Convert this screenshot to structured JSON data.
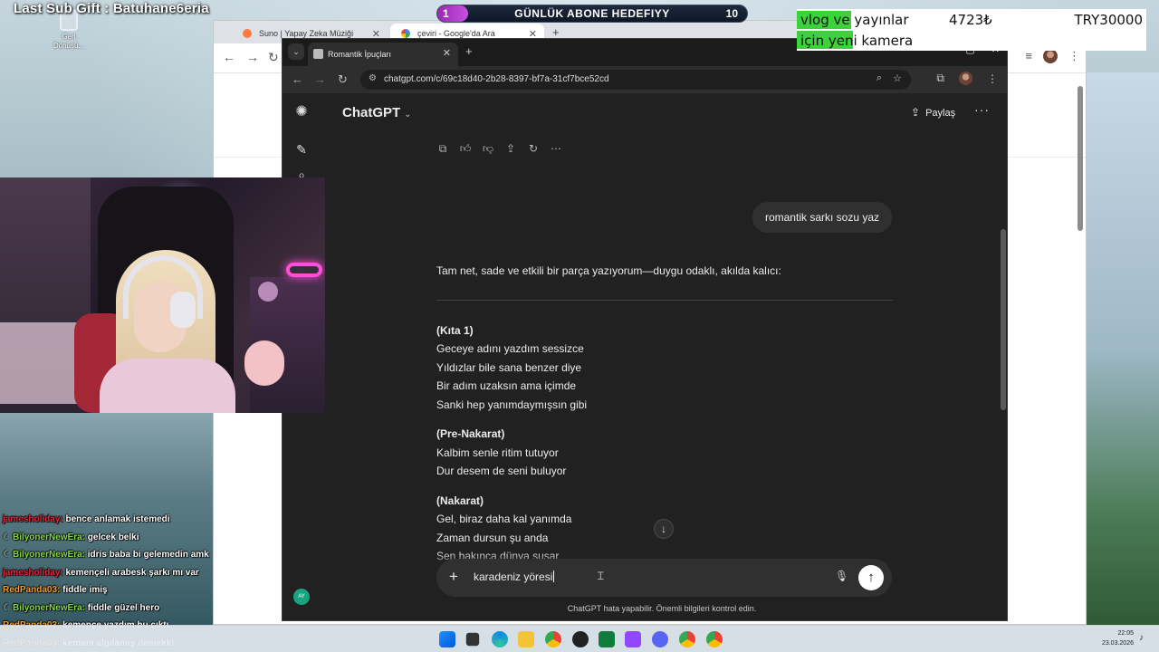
{
  "overlay": {
    "last_sub": "Last Sub Gift : Batuhane6eria",
    "goal": {
      "current": "1",
      "label": "GÜNLÜK ABONE HEDEFIYY",
      "max": "10",
      "progress_fraction": 0.1
    },
    "donation": {
      "line1": "vlog ve yayınlar",
      "line2": "için yeni kamera",
      "amount": "4723₺",
      "goal": "TRY30000"
    }
  },
  "desktop": {
    "recycle_bin": "Geri Dönüşü..."
  },
  "bg_browser": {
    "tabs": [
      {
        "label": "Suno | Yapay Zeka Müziği"
      },
      {
        "label": "çeviri - Google'da Ara"
      }
    ]
  },
  "browser": {
    "tab_title": "Romantik İpuçları",
    "url": "chatgpt.com/c/69c18d40-2b28-8397-bf7a-31cf7bce52cd"
  },
  "chatgpt": {
    "model": "ChatGPT",
    "share_label": "Paylaş",
    "user_message": "romantik sarkı sozu yaz",
    "reply": {
      "intro": "Tam net, sade ve etkili bir parça yazıyorum—duygu odaklı, akılda kalıcı:",
      "stanzas": [
        {
          "head": "(Kıta 1)",
          "lines": [
            "Geceye adını yazdım sessizce",
            "Yıldızlar bile sana benzer diye",
            "Bir adım uzaksın ama içimde",
            "Sanki hep yanımdaymışsın gibi"
          ]
        },
        {
          "head": "(Pre-Nakarat)",
          "lines": [
            "Kalbim senle ritim tutuyor",
            "Dur desem de seni buluyor"
          ]
        },
        {
          "head": "(Nakarat)",
          "lines": [
            "Gel, biraz daha kal yanımda",
            "Zaman dursun şu anda",
            "Sen bakınca dünya susar"
          ]
        }
      ]
    },
    "input_value": "karadeniz yöresi",
    "disclaimer": "ChatGPT hata yapabilir. Önemli bilgileri kontrol edin.",
    "user_initials": "AY"
  },
  "chat_overlay": [
    {
      "badge": false,
      "user": "jamesholiday:",
      "user_color": "#e8253b",
      "msg": "bence anlamak istemedi"
    },
    {
      "badge": true,
      "user": "BilyonerNewEra:",
      "user_color": "#7fdc3f",
      "msg": "gelcek belki"
    },
    {
      "badge": true,
      "user": "BilyonerNewEra:",
      "user_color": "#7fdc3f",
      "msg": "idris baba bi gelemedin amk"
    },
    {
      "badge": false,
      "user": "jamesholiday:",
      "user_color": "#e8253b",
      "msg": "kemençeli arabesk şarkı mı var"
    },
    {
      "badge": false,
      "user": "RedPanda03:",
      "user_color": "#f0a030",
      "msg": "fiddle imiş"
    },
    {
      "badge": true,
      "user": "BilyonerNewEra:",
      "user_color": "#7fdc3f",
      "msg": "fiddle güzel hero"
    },
    {
      "badge": false,
      "user": "RedPanda03:",
      "user_color": "#f0a030",
      "msg": "kemençe yazdım bu çıktı"
    },
    {
      "badge": false,
      "user": "RedPanda03:",
      "user_color": "#f0a030",
      "msg": "kemanı algılamış demekki"
    }
  ],
  "taskbar": {
    "time": "22:05",
    "date": "23.03.2026"
  }
}
